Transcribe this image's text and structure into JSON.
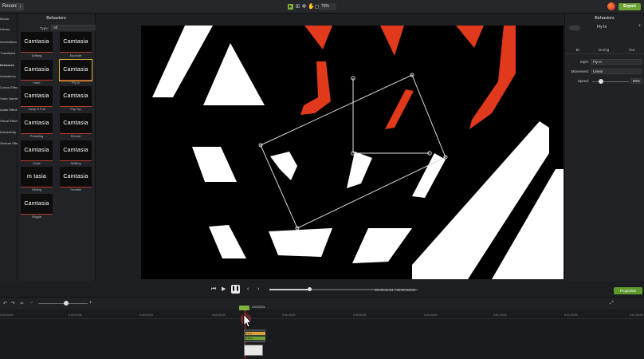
{
  "topbar": {
    "record_label": "Record",
    "chevron": "›",
    "zoom_value": "70%",
    "export_label": "Export",
    "tools": [
      "arrow-icon",
      "crop-icon",
      "pan-icon",
      "hand-icon",
      "crop-select-icon"
    ]
  },
  "sidenav": {
    "items": [
      "Media",
      "Library",
      "Annotations",
      "Transitions",
      "Behaviors",
      "Animations",
      "Cursor Effects",
      "Voice Narration",
      "Audio Effects",
      "Visual Effects",
      "Interactivity",
      "Gesture Effects"
    ]
  },
  "behaviors": {
    "title": "Behaviors",
    "type_label": "Type:",
    "type_value": "All",
    "thumbs": [
      {
        "text": "Camtasia",
        "label": "Drifting"
      },
      {
        "text": "Camtasia",
        "label": "Explode"
      },
      {
        "text": "Camtasia",
        "label": "Fade"
      },
      {
        "text": "Camtasia",
        "label": "Fly In"
      },
      {
        "text": "Camtasia",
        "label": "Jump & Fall"
      },
      {
        "text": "Camtasia",
        "label": "Pop Up"
      },
      {
        "text": "Camtasia",
        "label": "Pulsating"
      },
      {
        "text": "Camtasia",
        "label": "Reveal"
      },
      {
        "text": "Camtasia",
        "label": "Scale"
      },
      {
        "text": "Camtasia",
        "label": "Shifting"
      },
      {
        "text": "m tasia",
        "label": "Sliding"
      },
      {
        "text": "Camtasia",
        "label": "Tremble"
      },
      {
        "text": "Camtasia",
        "label": "Wiggle"
      }
    ]
  },
  "props": {
    "title": "Behaviors",
    "behavior_name": "Fly In",
    "tabs": {
      "in": "In",
      "during": "During",
      "out": "Out"
    },
    "style_label": "Style:",
    "style_value": "Fly In",
    "movement_label": "Movement:",
    "movement_value": "Linear",
    "speed_label": "Speed:",
    "speed_value": "80%"
  },
  "playback": {
    "timecode": "00:00:02;01 / 00:00:30;00",
    "progress": 0.27,
    "properties_label": "Properties"
  },
  "timeline": {
    "playhead_time": "0:00:03;01",
    "ticks": [
      "0:00:00;00",
      "0:00:10;00",
      "0:00:20;00",
      "0:00:30;00",
      "0:00:40;00",
      "0:00:50;00",
      "0:01:00;00",
      "0:01:10;00",
      "0:01:20;00",
      "0:01:30;00",
      "0:01:40;00"
    ],
    "clip_label_1": "Fly In",
    "clip_label_2": "Tilting"
  },
  "colors": {
    "accent_green": "#6aa331",
    "canvas_red": "#e0391c"
  }
}
